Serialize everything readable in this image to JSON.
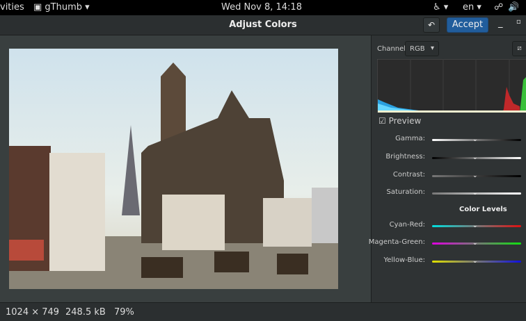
{
  "topbar": {
    "activities": "vities",
    "app": "gThumb ▾",
    "clock": "Wed Nov  8, 14:18",
    "lang": "en ▾"
  },
  "header": {
    "title": "Adjust Colors",
    "accept": "Accept",
    "undo_icon": "undo-icon"
  },
  "sidebar": {
    "channel_label": "Channel:",
    "channel_value": "RGB",
    "preview_label": "Preview",
    "preview_checked": true,
    "sliders": [
      {
        "label": "Gamma:",
        "value": 0,
        "colors": [
          "#ffffff",
          "#000000"
        ]
      },
      {
        "label": "Brightness:",
        "value": 0,
        "colors": [
          "#000000",
          "#ffffff"
        ]
      },
      {
        "label": "Contrast:",
        "value": 0,
        "colors": [
          "#777777",
          "#000000"
        ]
      },
      {
        "label": "Saturation:",
        "value": 0,
        "colors": [
          "#777777",
          "#ffffff"
        ]
      }
    ],
    "color_levels_title": "Color Levels",
    "levels": [
      {
        "label": "Cyan-Red:",
        "value": 0,
        "colors": [
          "#00e0e0",
          "#e01010"
        ]
      },
      {
        "label": "Magenta-Green:",
        "value": 0,
        "colors": [
          "#e000e0",
          "#10e010"
        ]
      },
      {
        "label": "Yellow-Blue:",
        "value": 0,
        "colors": [
          "#e0e000",
          "#1010e0"
        ]
      }
    ]
  },
  "status": {
    "dimensions": "1024 × 749",
    "size": "248.5 kB",
    "zoom": "79%"
  }
}
